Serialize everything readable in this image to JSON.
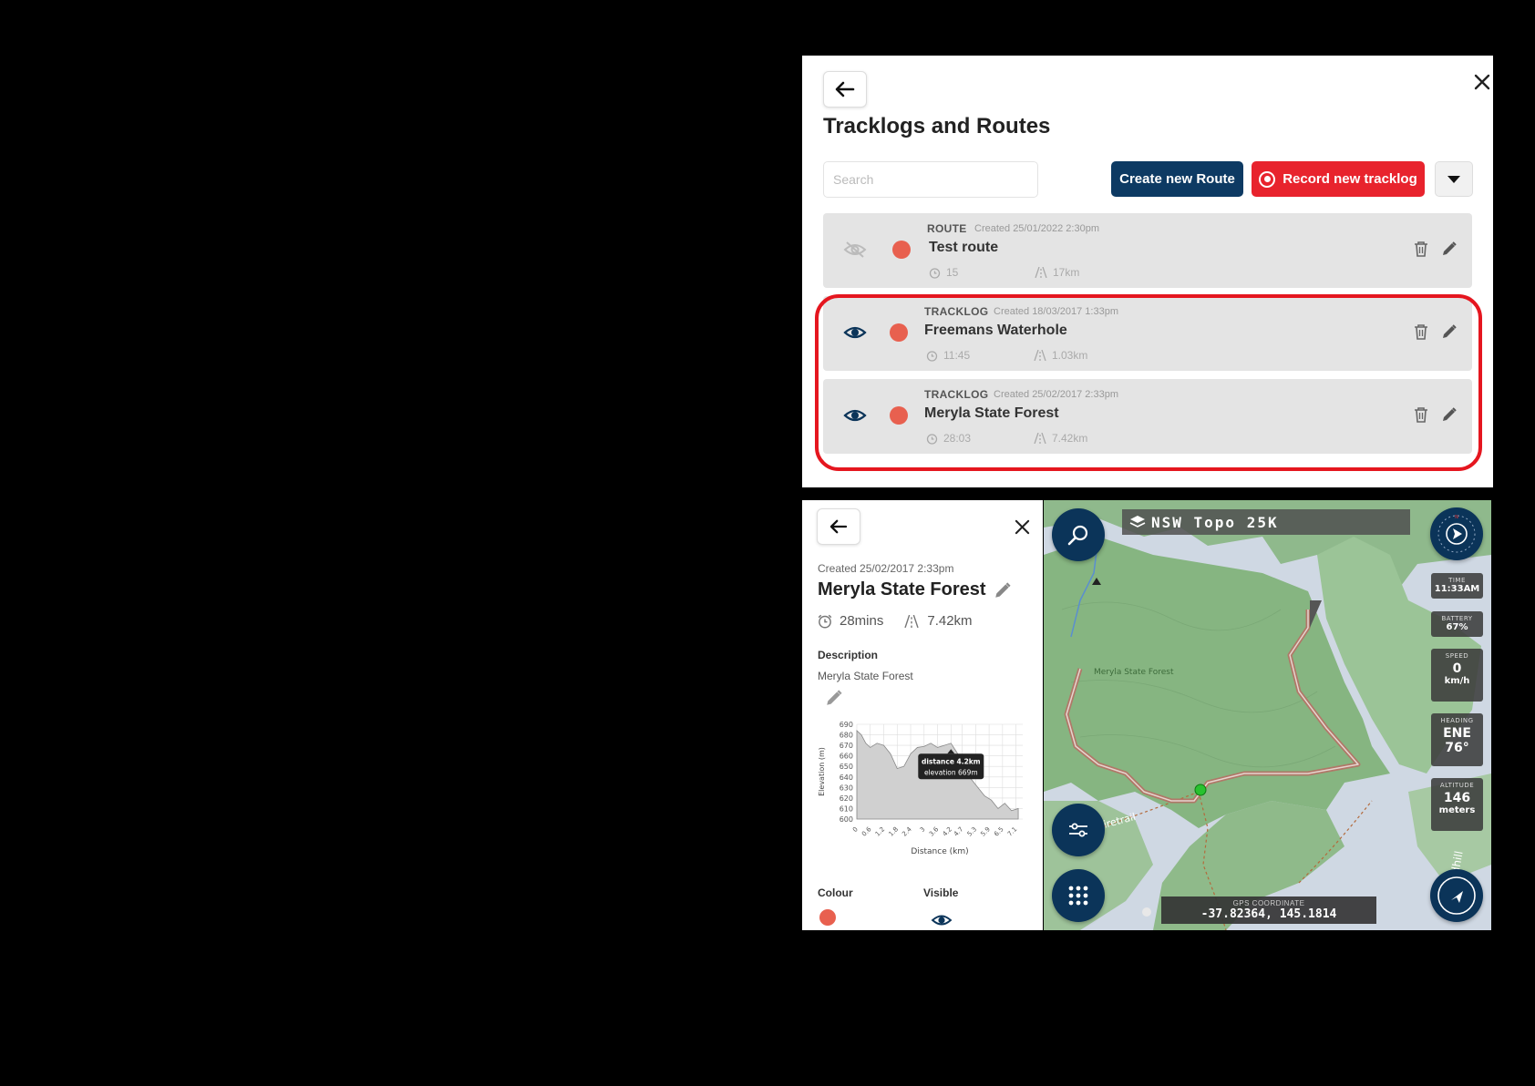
{
  "tracklogs_panel": {
    "title": "Tracklogs and Routes",
    "search_placeholder": "Search",
    "create_route_label": "Create new Route",
    "record_tracklog_label": "Record new tracklog",
    "items": [
      {
        "kind": "ROUTE",
        "created": "Created 25/01/2022 2:30pm",
        "name": "Test route",
        "time": "15",
        "distance": "17km",
        "visible": false,
        "colour": "#e8604f"
      },
      {
        "kind": "TRACKLOG",
        "created": "Created 18/03/2017 1:33pm",
        "name": "Freemans Waterhole",
        "time": "11:45",
        "distance": "1.03km",
        "visible": true,
        "colour": "#e8604f"
      },
      {
        "kind": "TRACKLOG",
        "created": "Created 25/02/2017 2:33pm",
        "name": "Meryla State Forest",
        "time": "28:03",
        "distance": "7.42km",
        "visible": true,
        "colour": "#e8604f"
      }
    ]
  },
  "detail_panel": {
    "created": "Created 25/02/2017 2:33pm",
    "title": "Meryla State Forest",
    "duration": "28mins",
    "distance": "7.42km",
    "description_label": "Description",
    "description_text": "Meryla State Forest",
    "colour_label": "Colour",
    "visible_label": "Visible",
    "colour": "#e8604f"
  },
  "chart_data": {
    "type": "area",
    "xlabel": "Distance (km)",
    "ylabel": "Elevation (m)",
    "x_ticks": [
      "0",
      "0.6",
      "1.2",
      "1.8",
      "2.4",
      "3",
      "3.6",
      "4.2",
      "4.7",
      "5.3",
      "5.9",
      "6.5",
      "7.1"
    ],
    "y_ticks": [
      600,
      610,
      620,
      630,
      640,
      650,
      660,
      670,
      680,
      690
    ],
    "ylim": [
      600,
      690
    ],
    "xlim": [
      0,
      7.4
    ],
    "x": [
      0,
      0.2,
      0.4,
      0.6,
      0.9,
      1.2,
      1.5,
      1.8,
      2.1,
      2.4,
      2.7,
      3.0,
      3.3,
      3.6,
      3.9,
      4.2,
      4.5,
      4.8,
      5.1,
      5.4,
      5.7,
      6.0,
      6.3,
      6.6,
      6.9,
      7.2
    ],
    "y": [
      684,
      680,
      672,
      668,
      672,
      670,
      662,
      648,
      650,
      662,
      668,
      669,
      672,
      668,
      670,
      672,
      662,
      648,
      638,
      630,
      622,
      618,
      610,
      615,
      608,
      610
    ],
    "tooltip": {
      "line1": "distance 4.2km",
      "line2": "elevation 669m"
    },
    "grid": true
  },
  "map": {
    "layer_name": "NSW Topo 25K",
    "map_label_forest": "Meryla State Forest",
    "map_label_trail": "Firetrail",
    "map_label_road": "Redhill",
    "time_label": "TIME",
    "time_value": "11:33AM",
    "battery_label": "BATTERY",
    "battery_value": "67%",
    "speed_label": "SPEED",
    "speed_value": "0",
    "speed_unit": "km/h",
    "heading_label": "HEADING",
    "heading_value": "ENE",
    "heading_degrees": "76°",
    "altitude_label": "ALTITUDE",
    "altitude_value": "146",
    "altitude_unit": "meters",
    "gps_label": "GPS COORDINATE",
    "gps_value": "-37.82364, 145.1814"
  }
}
